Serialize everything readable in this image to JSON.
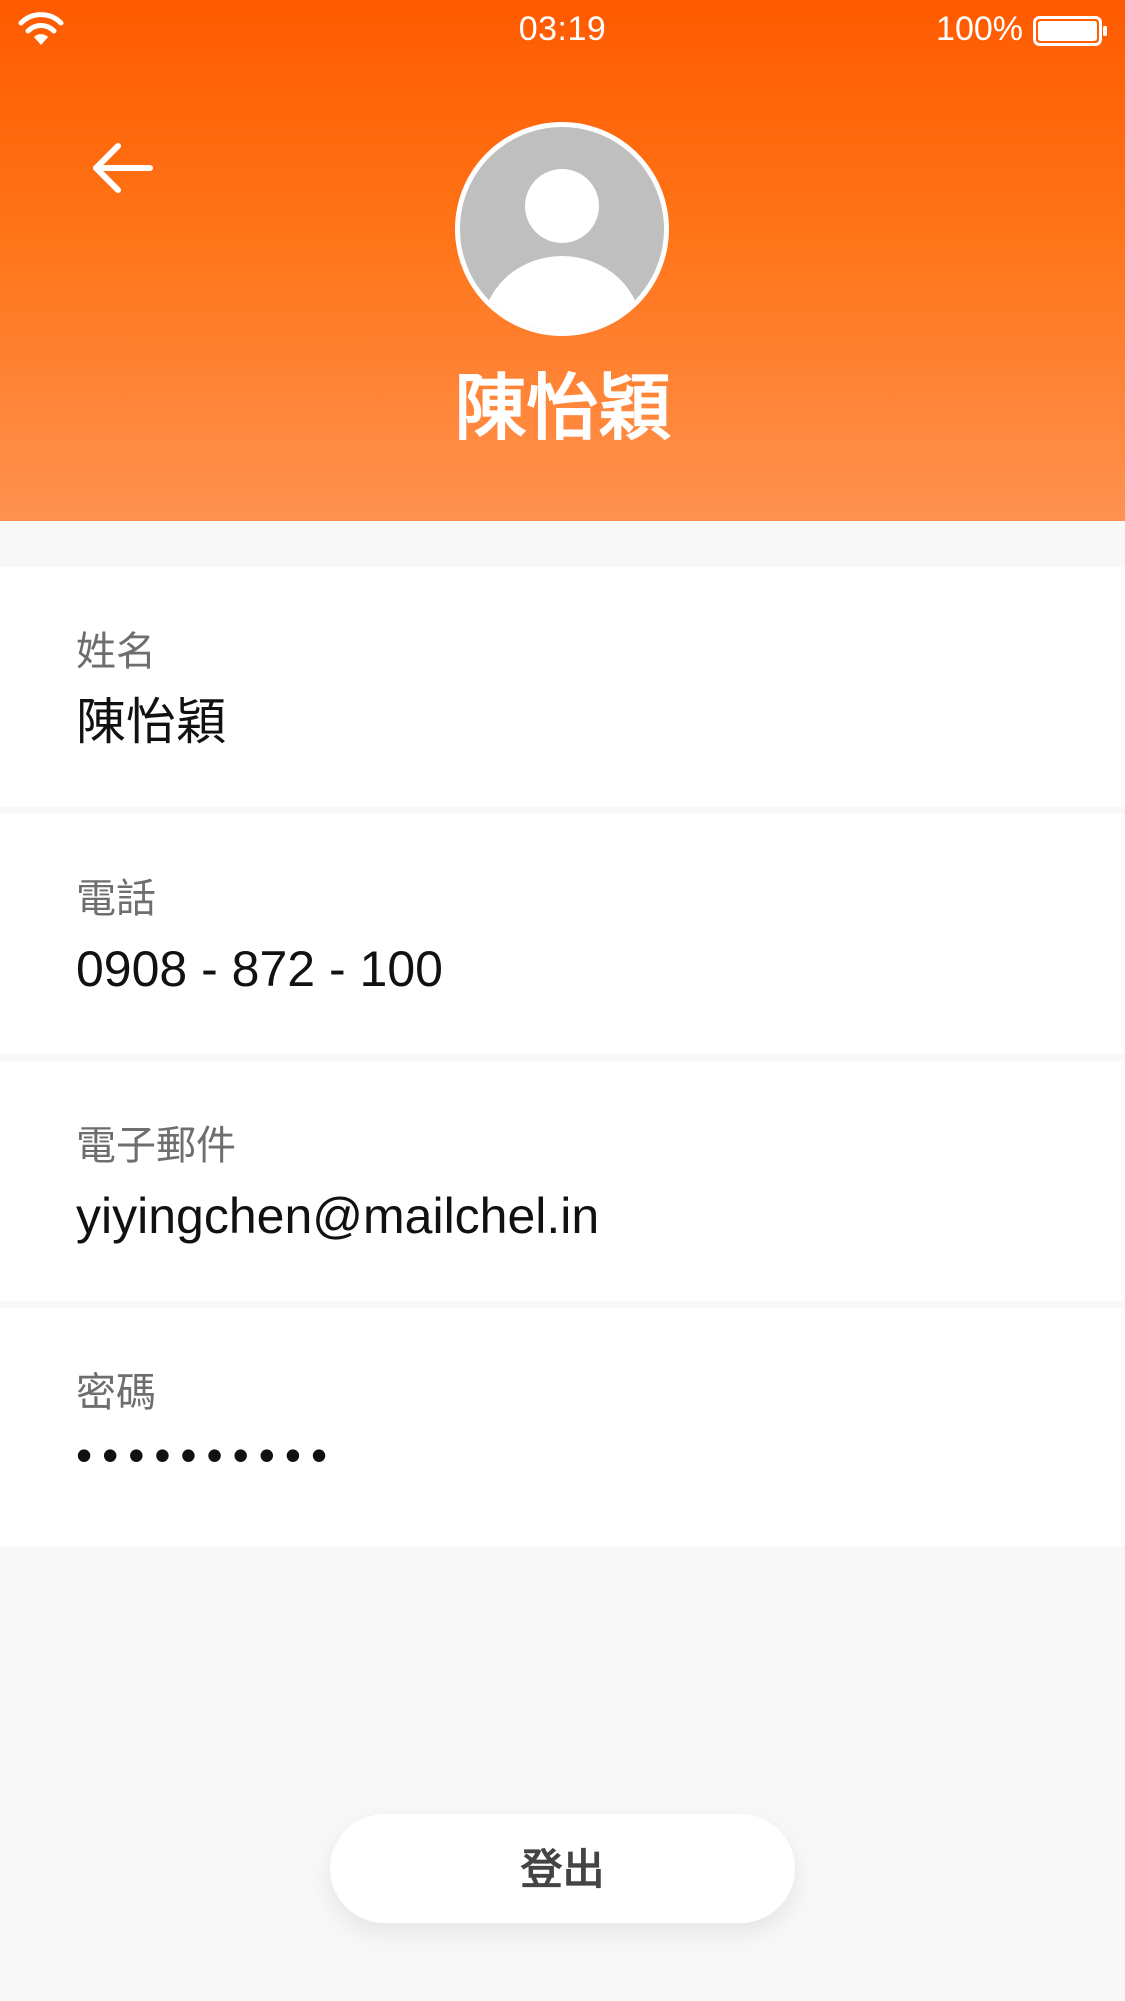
{
  "status_bar": {
    "time": "03:19",
    "battery_percent": "100%",
    "icons": [
      "wifi-icon",
      "battery-icon"
    ]
  },
  "header": {
    "back_icon": "arrow-left-icon",
    "avatar_icon": "user-placeholder-icon",
    "name": "陳怡穎"
  },
  "fields": [
    {
      "label": "姓名",
      "value": "陳怡穎"
    },
    {
      "label": "電話",
      "value": "0908 - 872 - 100"
    },
    {
      "label": "電子郵件",
      "value": "yiyingchen@mailchel.in"
    },
    {
      "label": "密碼",
      "value": "••••••••••"
    }
  ],
  "logout": {
    "label": "登出"
  },
  "colors": {
    "accent_top": "#ff5a00",
    "accent_bottom": "#ff9250",
    "background": "#f8f8f8",
    "avatar_gray": "#bfbfbf"
  }
}
